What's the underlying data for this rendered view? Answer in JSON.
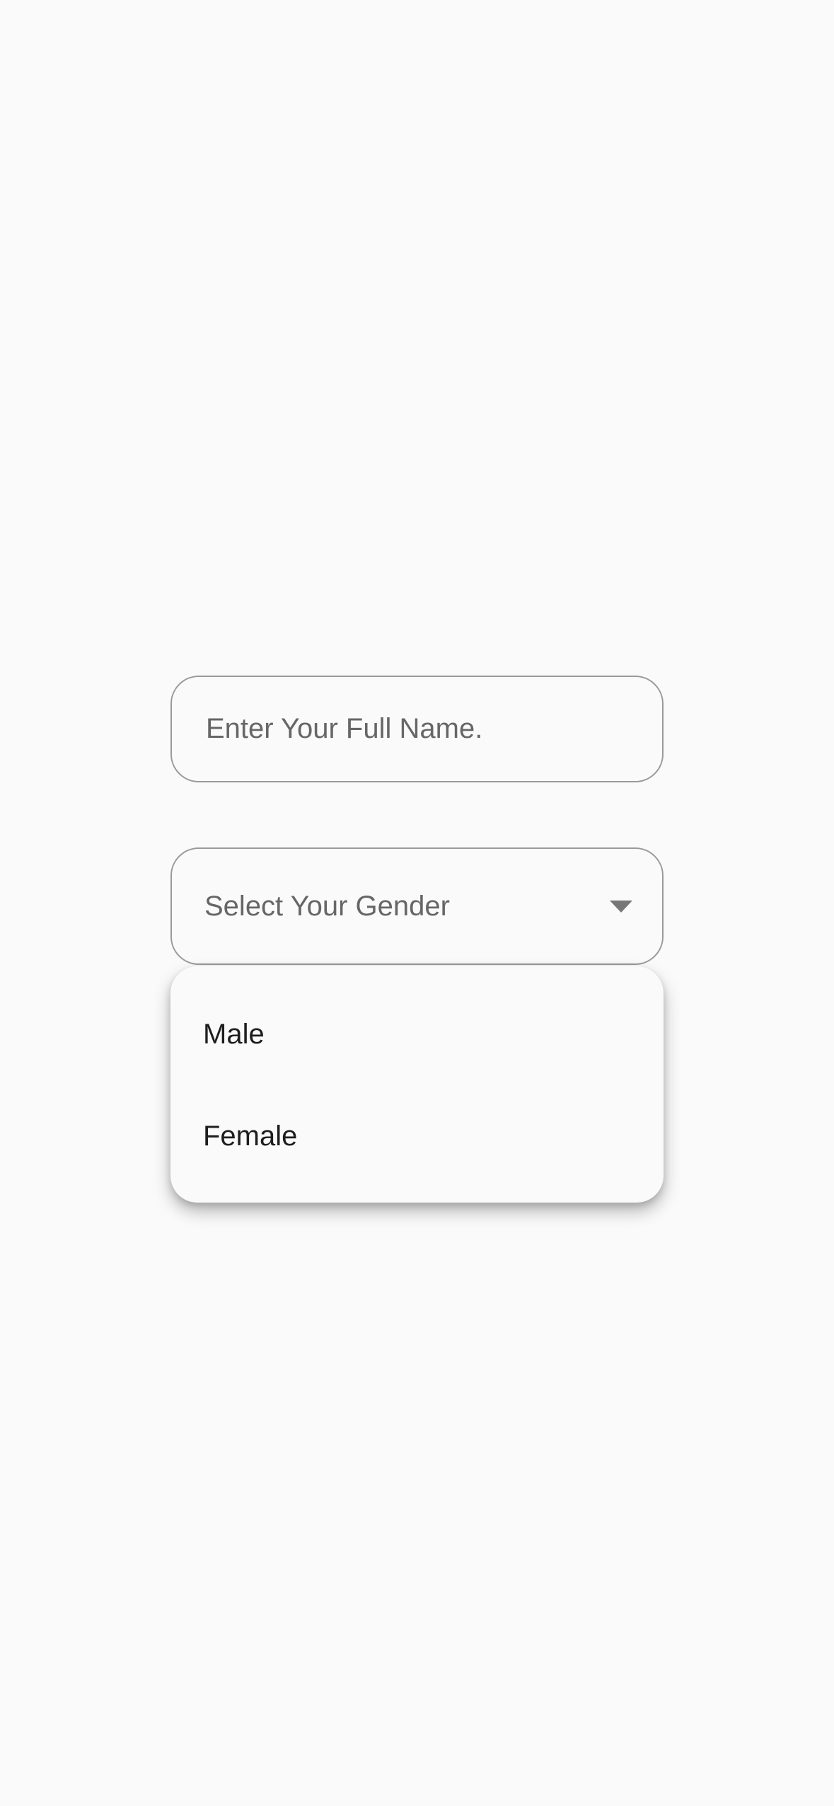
{
  "form": {
    "name_placeholder": "Enter Your Full Name.",
    "name_value": "",
    "gender_placeholder": "Select Your Gender",
    "gender_options": [
      "Male",
      "Female"
    ]
  },
  "colors": {
    "background": "#fafafa",
    "border": "#9a9a9a",
    "placeholder_text": "#666666",
    "menu_text": "#1e1e1e"
  },
  "icons": {
    "dropdown": "caret-down-icon"
  }
}
